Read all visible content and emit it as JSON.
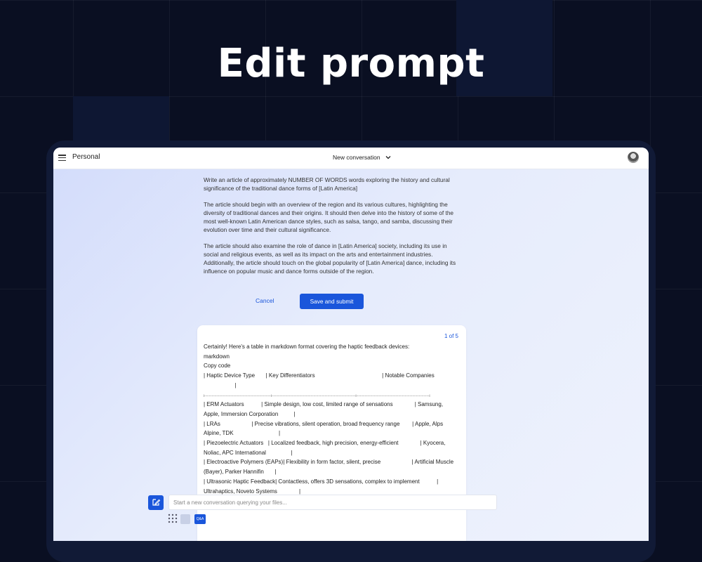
{
  "hero": {
    "title": "Edit prompt"
  },
  "topbar": {
    "workspace": "Personal",
    "conversation_title": "New conversation"
  },
  "prompt": {
    "paragraphs": [
      "Write an article of approximately NUMBER OF WORDS words exploring the history and cultural significance of the traditional dance forms of [Latin America]",
      "The article should begin with an overview of the region and its various cultures, highlighting the diversity of traditional dances and their origins. It should then delve into the history of some of the most well-known Latin American dance styles, such as salsa, tango, and samba, discussing their evolution over time and their cultural significance.",
      "The article should also examine the role of dance in [Latin America] society, including its use in social and religious events, as well as its impact on the arts and entertainment industries. Additionally, the article should touch on the global popularity of [Latin America] dance, including its influence on popular music and dance forms outside of the region."
    ]
  },
  "actions": {
    "cancel": "Cancel",
    "save": "Save and submit"
  },
  "answer": {
    "pager": "1 of 5",
    "lines": [
      "Certainly! Here's a table in markdown format covering the haptic feedback devices:",
      "markdown",
      "Copy code",
      "| Haptic Device Type       | Key Differentiators                                           | Notable Companies",
      "                    |",
      "|-----------------------------------------------------------------------|------------------------------------------------------------------------------------------|------------------------------------------------------------------------------|",
      "| ERM Actuators           | Simple design, low cost, limited range of sensations              | Samsung,",
      "Apple, Immersion Corporation          |",
      "| LRAs                    | Precise vibrations, silent operation, broad frequency range        | Apple, Alps",
      "Alpine, TDK                             |",
      "| Piezoelectric Actuators   | Localized feedback, high precision, energy-efficient              | Kyocera,",
      "Noliac, APC International                |",
      "| Electroactive Polymers (EAPs)| Flexibility in form factor, silent, precise                    | Artificial Muscle",
      "(Bayer), Parker Hannifin       |",
      "| Ultrasonic Haptic Feedback| Contactless, offers 3D sensations, complex to implement           |",
      "Ultrahaptics, Noveto Systems              |"
    ]
  },
  "composer": {
    "placeholder": "Start a new conversation querying your files...",
    "qa_label": "Q&A"
  },
  "colors": {
    "accent": "#1a56db",
    "background": "#0a0f22"
  }
}
